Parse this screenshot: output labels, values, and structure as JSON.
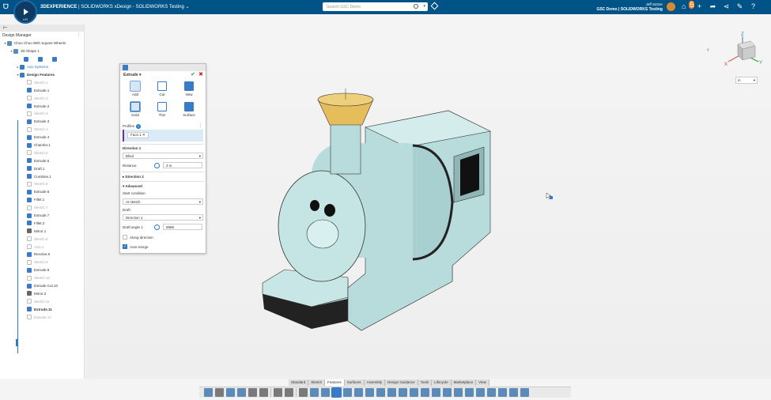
{
  "topbar": {
    "brand": "3DEXPERIENCE",
    "brand_suffix": " | SOLIDWORKS",
    "app": "xDesign - SOLIDWORKS Testing",
    "compass_version": "V.R",
    "search_placeholder": "Search GSC Demo",
    "user_name": "Jeff Setzer",
    "user_org": "GSC Demo | SOLIDWORKS Testing",
    "notification_count": "5",
    "icons": [
      "add-icon",
      "share-icon",
      "network-icon",
      "tools-icon",
      "help-icon"
    ]
  },
  "design_manager": {
    "title": "Design Manager",
    "tree": [
      {
        "label": "Choo Choo With Square Wheels",
        "level": 0,
        "type": "part",
        "expanded": true
      },
      {
        "label": "3D Shape 1",
        "level": 1,
        "type": "part",
        "expanded": true
      },
      {
        "label": "Axis Systems",
        "level": 2,
        "type": "folder",
        "expanded": false
      },
      {
        "label": "Design Features",
        "level": 2,
        "type": "folder",
        "expanded": true
      },
      {
        "label": "Sketch.1",
        "type": "sketch",
        "dim": true
      },
      {
        "label": "Extrude.1",
        "type": "feat"
      },
      {
        "label": "Sketch.2",
        "type": "sketch",
        "dim": true
      },
      {
        "label": "Extrude.2",
        "type": "feat"
      },
      {
        "label": "Sketch.3",
        "type": "sketch",
        "dim": true
      },
      {
        "label": "Extrude.3",
        "type": "feat"
      },
      {
        "label": "Sketch.4",
        "type": "sketch",
        "dim": true
      },
      {
        "label": "Extrude.4",
        "type": "feat"
      },
      {
        "label": "Chamfer.1",
        "type": "feat"
      },
      {
        "label": "Sketch.5",
        "type": "sketch",
        "dim": true
      },
      {
        "label": "Extrude.5",
        "type": "feat"
      },
      {
        "label": "Draft.1",
        "type": "feat"
      },
      {
        "label": "Combine.1",
        "type": "feat"
      },
      {
        "label": "Sketch.6",
        "type": "sketch",
        "dim": true
      },
      {
        "label": "Extrude.6",
        "type": "feat"
      },
      {
        "label": "Fillet.1",
        "type": "feat"
      },
      {
        "label": "Sketch.7",
        "type": "sketch",
        "dim": true
      },
      {
        "label": "Extrude.7",
        "type": "feat"
      },
      {
        "label": "Fillet.2",
        "type": "feat"
      },
      {
        "label": "Mirror.1",
        "type": "mirror"
      },
      {
        "label": "Sketch.8",
        "type": "sketch",
        "dim": true
      },
      {
        "label": "Axis.1",
        "type": "sketch",
        "dim": true
      },
      {
        "label": "Revolve.8",
        "type": "feat"
      },
      {
        "label": "Sketch.9",
        "type": "sketch",
        "dim": true
      },
      {
        "label": "Extrude.9",
        "type": "feat"
      },
      {
        "label": "Sketch.10",
        "type": "sketch",
        "dim": true
      },
      {
        "label": "Extrude Cut.10",
        "type": "feat"
      },
      {
        "label": "Mirror.2",
        "type": "mirror"
      },
      {
        "label": "Sketch.11",
        "type": "sketch",
        "dim": true
      },
      {
        "label": "Extrude.11",
        "type": "feat",
        "bold": true
      },
      {
        "label": "Extrude.12",
        "type": "sketch",
        "dim": true
      }
    ]
  },
  "extrude_panel": {
    "title": "Extrude",
    "operations": [
      "Add",
      "Cut",
      "New",
      "Solid",
      "Thin",
      "Surface"
    ],
    "profiles_label": "Profiles",
    "profiles_count": "1",
    "profile_chip": "Face.1",
    "direction1_label": "Direction 1",
    "end_condition": "Blind",
    "distance_label": "Distance",
    "distance_value": "3 in",
    "direction2_label": "Direction 2",
    "advanced_label": "Advanced",
    "start_condition_label": "Start condition",
    "start_condition": "At sketch",
    "draft_label": "Draft",
    "draft_value": "Direction 1",
    "draft_angle_label": "Draft angle 1",
    "draft_angle_value": "8888",
    "along_direction_label": "Along direction",
    "automerge_label": "Auto-merge"
  },
  "viewport": {
    "units": "in",
    "axes": {
      "x": "X",
      "y": "Y",
      "z": "Z"
    }
  },
  "command_tabs": [
    "Standard",
    "Sketch",
    "Features",
    "Surfaces",
    "Assembly",
    "Design Guidance",
    "Tools",
    "Lifecycle",
    "Marketplace",
    "View"
  ],
  "active_tab": "Features",
  "colors": {
    "topbar": "#005386",
    "accent": "#2d78c2",
    "model_body": "#b8dcdc",
    "stack_top": "#e8bd5a"
  }
}
